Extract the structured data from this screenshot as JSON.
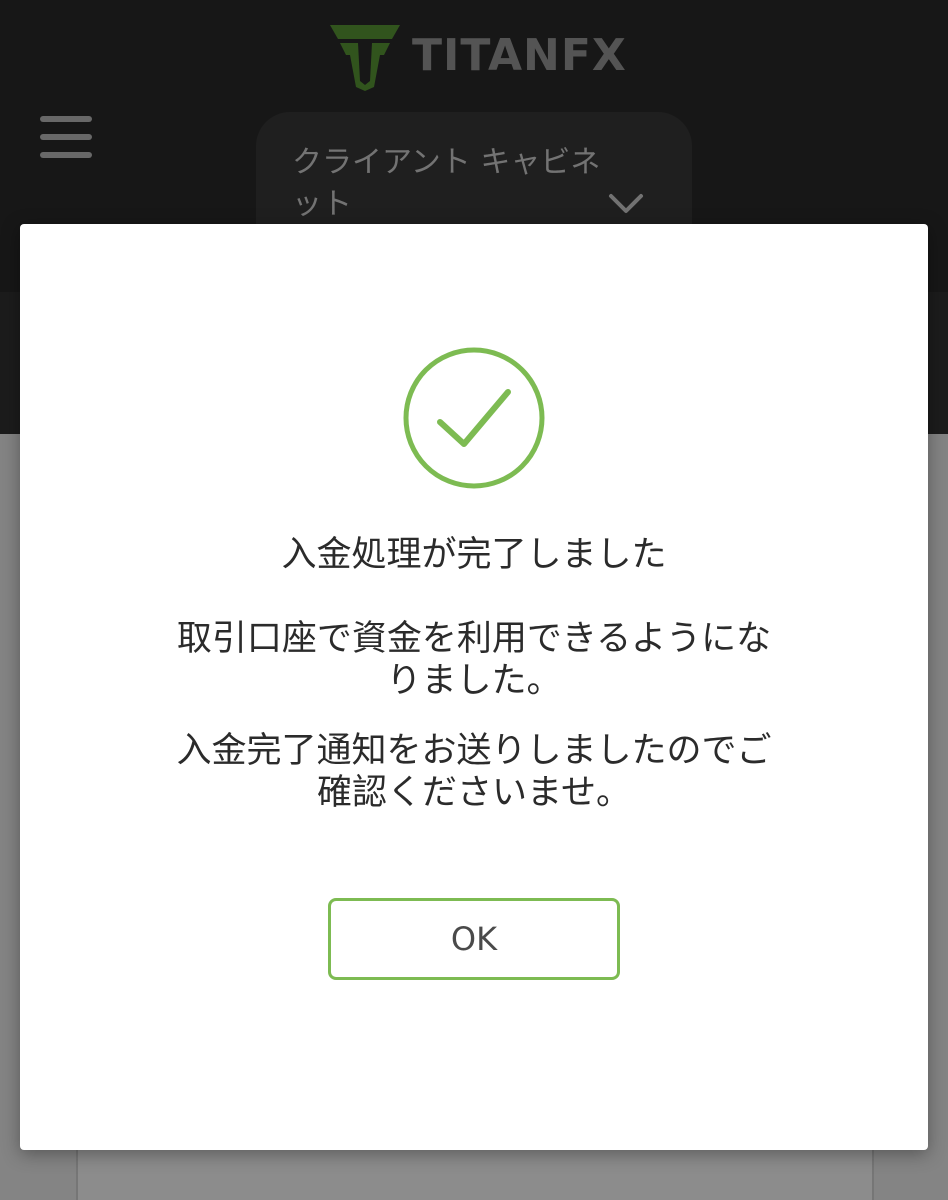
{
  "header": {
    "logo_text": "TITANFX",
    "nav_dropdown_label": "クライアント キャビネット"
  },
  "dialog": {
    "title": "入金処理が完了しました",
    "message_1": "取引口座で資金を利用できるようになりました。",
    "message_2": "入金完了通知をお送りしましたのでご確認くださいませ。",
    "ok_label": "OK"
  },
  "icons": {
    "logo": "titanfx-shield-logo",
    "menu": "hamburger-menu-icon",
    "dropdown": "chevron-down-icon",
    "success": "check-circle-icon"
  },
  "colors": {
    "accent_green": "#7dbb52",
    "header_bg": "#2a2a2a",
    "logo_text": "#9a9a9a"
  }
}
